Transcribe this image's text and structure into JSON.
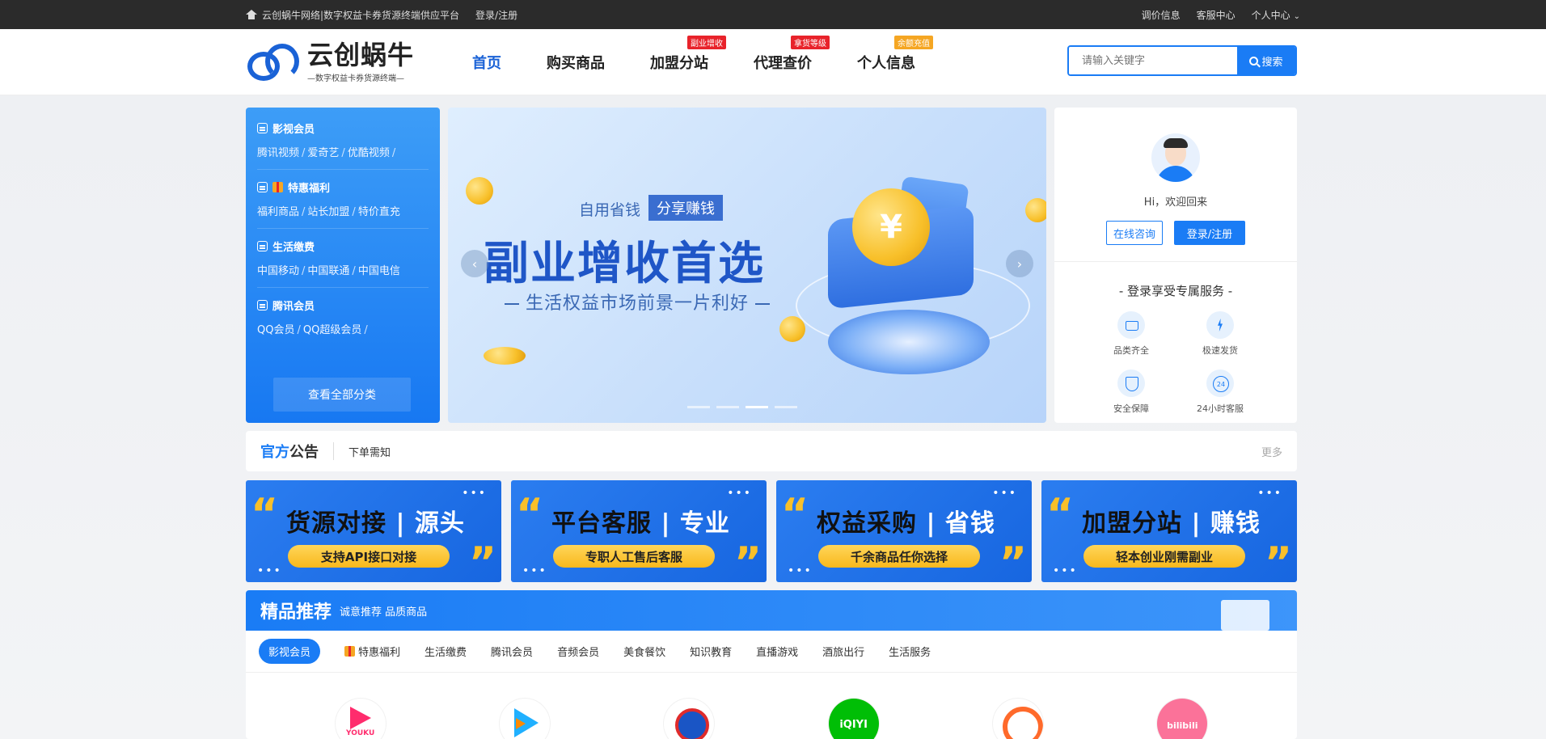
{
  "topbar": {
    "site_title": "云创蜗牛网络|数字权益卡券货源终端供应平台",
    "login": "登录/注册",
    "links": [
      "调价信息",
      "客服中心",
      "个人中心"
    ]
  },
  "header": {
    "logo_title": "云创蜗牛",
    "logo_sub": "—数字权益卡券货源终端—",
    "nav": [
      {
        "label": "首页",
        "badge": ""
      },
      {
        "label": "购买商品",
        "badge": ""
      },
      {
        "label": "加盟分站",
        "badge": "副业增收"
      },
      {
        "label": "代理查价",
        "badge": "拿货等级"
      },
      {
        "label": "个人信息",
        "badge": "余额充值"
      }
    ],
    "search_placeholder": "请输入关键字",
    "search_button": "搜索"
  },
  "categories": [
    {
      "title": "影视会员",
      "links": [
        "腾讯视频",
        "爱奇艺",
        "优酷视频"
      ]
    },
    {
      "title": "特惠福利",
      "links": [
        "福利商品",
        "站长加盟",
        "特价直充"
      ]
    },
    {
      "title": "生活缴费",
      "links": [
        "中国移动",
        "中国联通",
        "中国电信"
      ]
    },
    {
      "title": "腾讯会员",
      "links": [
        "QQ会员",
        "QQ超级会员"
      ]
    }
  ],
  "categories_all": "查看全部分类",
  "banner": {
    "tag1": "自用省钱",
    "tag2": "分享赚钱",
    "title": "副业增收首选",
    "subtitle": "生活权益市场前景一片利好",
    "yen": "¥",
    "prev": "‹",
    "next": "›"
  },
  "user": {
    "greeting": "Hi，欢迎回来",
    "consult": "在线咨询",
    "login": "登录/注册",
    "service_title": "- 登录享受专属服务 -",
    "services": [
      "品类齐全",
      "极速发货",
      "安全保障",
      "24小时客服"
    ]
  },
  "notice": {
    "title_hl": "官方",
    "title_rest": "公告",
    "item": "下单需知",
    "more": "更多"
  },
  "promos": [
    {
      "a": "货源对接",
      "b": "源头",
      "pill": "支持API接口对接"
    },
    {
      "a": "平台客服",
      "b": "专业",
      "pill": "专职人工售后客服"
    },
    {
      "a": "权益采购",
      "b": "省钱",
      "pill": "千余商品任你选择"
    },
    {
      "a": "加盟分站",
      "b": "赚钱",
      "pill": "轻本创业刚需副业"
    }
  ],
  "featured": {
    "title": "精品推荐",
    "sub": "诚意推荐 品质商品",
    "tabs": [
      "影视会员",
      "特惠福利",
      "生活缴费",
      "腾讯会员",
      "音频会员",
      "美食餐饮",
      "知识教育",
      "直播游戏",
      "酒旅出行",
      "生活服务"
    ],
    "brands": [
      "YOUKU",
      "",
      "",
      "iQIYI",
      "",
      "bilibili"
    ]
  },
  "colors": {
    "primary": "#1a7cf5",
    "badge_red": "#e8232b",
    "badge_orange": "#f5a623",
    "gold": "#f8c02a"
  }
}
